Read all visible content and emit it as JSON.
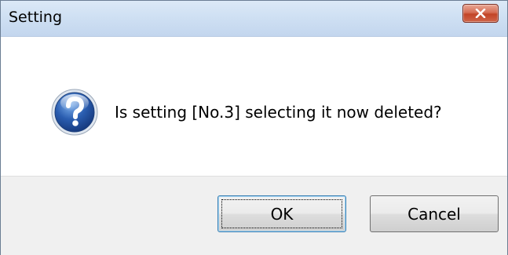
{
  "window": {
    "title": "Setting"
  },
  "dialog": {
    "icon": "question-icon",
    "message": "Is setting [No.3] selecting it now deleted?"
  },
  "buttons": {
    "ok_label": "OK",
    "cancel_label": "Cancel"
  },
  "colors": {
    "titlebar": "#cfe0f3",
    "close_button": "#c24427",
    "footer": "#f0f0f0",
    "icon_blue": "#2a5db0"
  }
}
